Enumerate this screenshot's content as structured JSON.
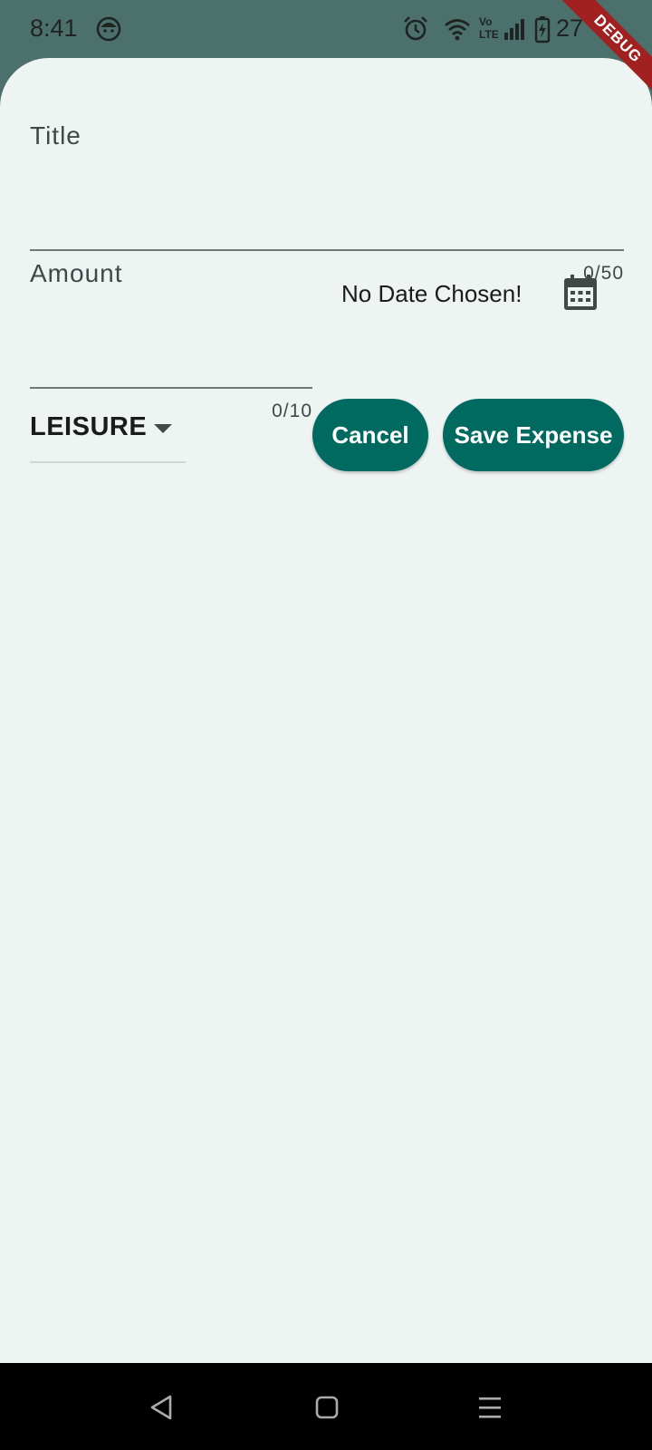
{
  "status_bar": {
    "time": "8:41",
    "battery_text": "27",
    "icons": [
      "face-notification-icon",
      "alarm-icon",
      "wifi-icon",
      "volte-icon",
      "signal-icon",
      "battery-charging-icon"
    ]
  },
  "debug_banner": {
    "label": "DEBUG",
    "color": "#a12121"
  },
  "form": {
    "title": {
      "label": "Title",
      "counter": "0/50"
    },
    "amount": {
      "label": "Amount",
      "counter": "0/10"
    },
    "date": {
      "text": "No Date Chosen!",
      "icon": "calendar-icon"
    },
    "category": {
      "selected": "LEISURE",
      "icon": "dropdown-arrow-icon"
    },
    "buttons": {
      "cancel": "Cancel",
      "save": "Save Expense"
    }
  },
  "navigation_bar": {
    "icons": [
      "back-icon",
      "home-icon",
      "menu-icon"
    ]
  },
  "colors": {
    "status_bar_bg": "#4c706b",
    "sheet_bg": "#eef4f2",
    "button_bg": "#006a60",
    "button_text": "#ffffff",
    "nav_bar_bg": "#000000"
  }
}
